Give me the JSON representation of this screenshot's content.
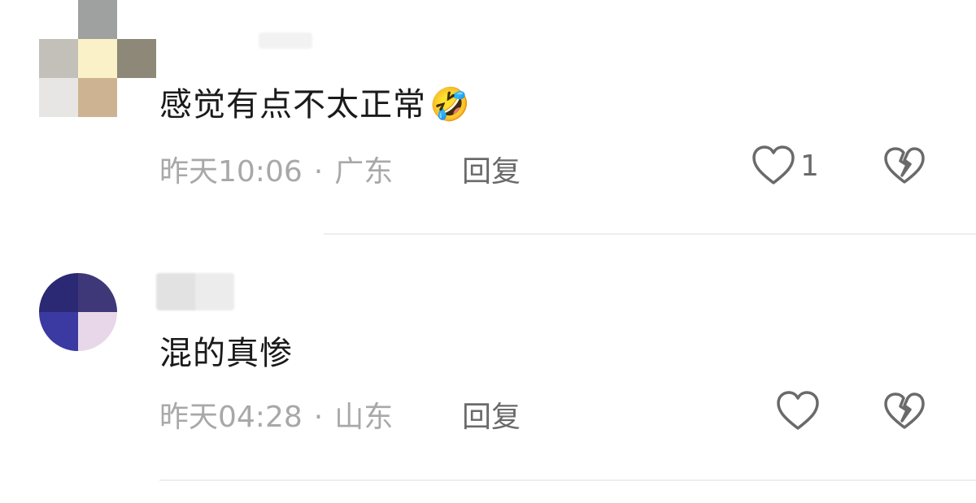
{
  "comments": [
    {
      "text": "感觉有点不太正常",
      "emoji": "🤣",
      "time": "昨天10:06",
      "location": "广东",
      "reply_label": "回复",
      "like_count": "1",
      "avatar_colors": [
        "#b9bab8",
        "#fbf1c8",
        "#8b8676",
        "#e7e6e4",
        "#cdb392",
        "#ffffff"
      ]
    },
    {
      "text": "混的真惨",
      "time": "昨天04:28",
      "location": "山东",
      "reply_label": "回复",
      "like_count": "",
      "avatar_colors": [
        "#2f2b73",
        "#3a3478",
        "#3a3aa0",
        "#e9d8e9"
      ]
    }
  ],
  "separator": "·"
}
